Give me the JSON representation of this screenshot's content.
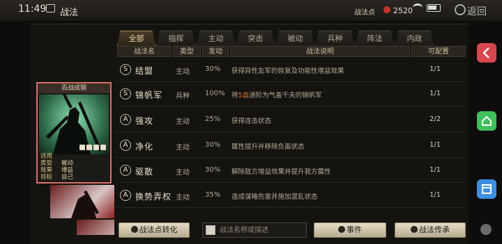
{
  "statusbar": {
    "time": "11:49",
    "title": "战法",
    "points_label": "战法点",
    "points_value": "2520",
    "back_label": "返回"
  },
  "tabs": [
    "全部",
    "指挥",
    "主动",
    "突击",
    "被动",
    "兵种",
    "阵法",
    "内政"
  ],
  "active_tab": 0,
  "columns": [
    "战法名",
    "类型",
    "发动",
    "战法说明",
    "可配置"
  ],
  "rows": [
    {
      "grade": "S",
      "name": "结盟",
      "type": "主动",
      "rate": "30%",
      "desc": "获得异性友军的恢复及功能性增益效果",
      "desc_highlight": "",
      "desc_tail": "",
      "cap": "1/1"
    },
    {
      "grade": "S",
      "name": "锦帆军",
      "type": "兵种",
      "rate": "100%",
      "desc": "将",
      "desc_highlight": "5",
      "desc_mid": "血",
      "desc_tail": "进阶为气盖千夫的锦帆军",
      "cap": "1/1"
    },
    {
      "grade": "A",
      "name": "强攻",
      "type": "主动",
      "rate": "25%",
      "desc": "获得连击状态",
      "desc_highlight": "",
      "desc_tail": "",
      "cap": "2/2"
    },
    {
      "grade": "A",
      "name": "净化",
      "type": "主动",
      "rate": "30%",
      "desc": "属性提升并移除负面状态",
      "desc_highlight": "",
      "desc_tail": "",
      "cap": "1/1"
    },
    {
      "grade": "A",
      "name": "驱散",
      "type": "主动",
      "rate": "30%",
      "desc": "解除敌方增益效果并提升我方属性",
      "desc_highlight": "",
      "desc_tail": "",
      "cap": "1/1"
    },
    {
      "grade": "A",
      "name": "换势弄权",
      "type": "主动",
      "rate": "35%",
      "desc": "造成谋略伤害并施加混乱状态",
      "desc_highlight": "",
      "desc_tail": "",
      "cap": "1/1"
    }
  ],
  "card": {
    "title": "百战成钢",
    "stats": [
      {
        "k": "适用",
        "v": ""
      },
      {
        "k": "类型",
        "v": "被动"
      },
      {
        "k": "效果",
        "v": "增益"
      },
      {
        "k": "目标",
        "v": "自己"
      }
    ]
  },
  "bottom": {
    "convert_label": "战法点转化",
    "search_placeholder": "战法名称或描述",
    "event_label": "事件",
    "inherit_label": "战法传承"
  },
  "colors": {
    "accent": "#e0772c",
    "card_border": "#d86f6a"
  }
}
